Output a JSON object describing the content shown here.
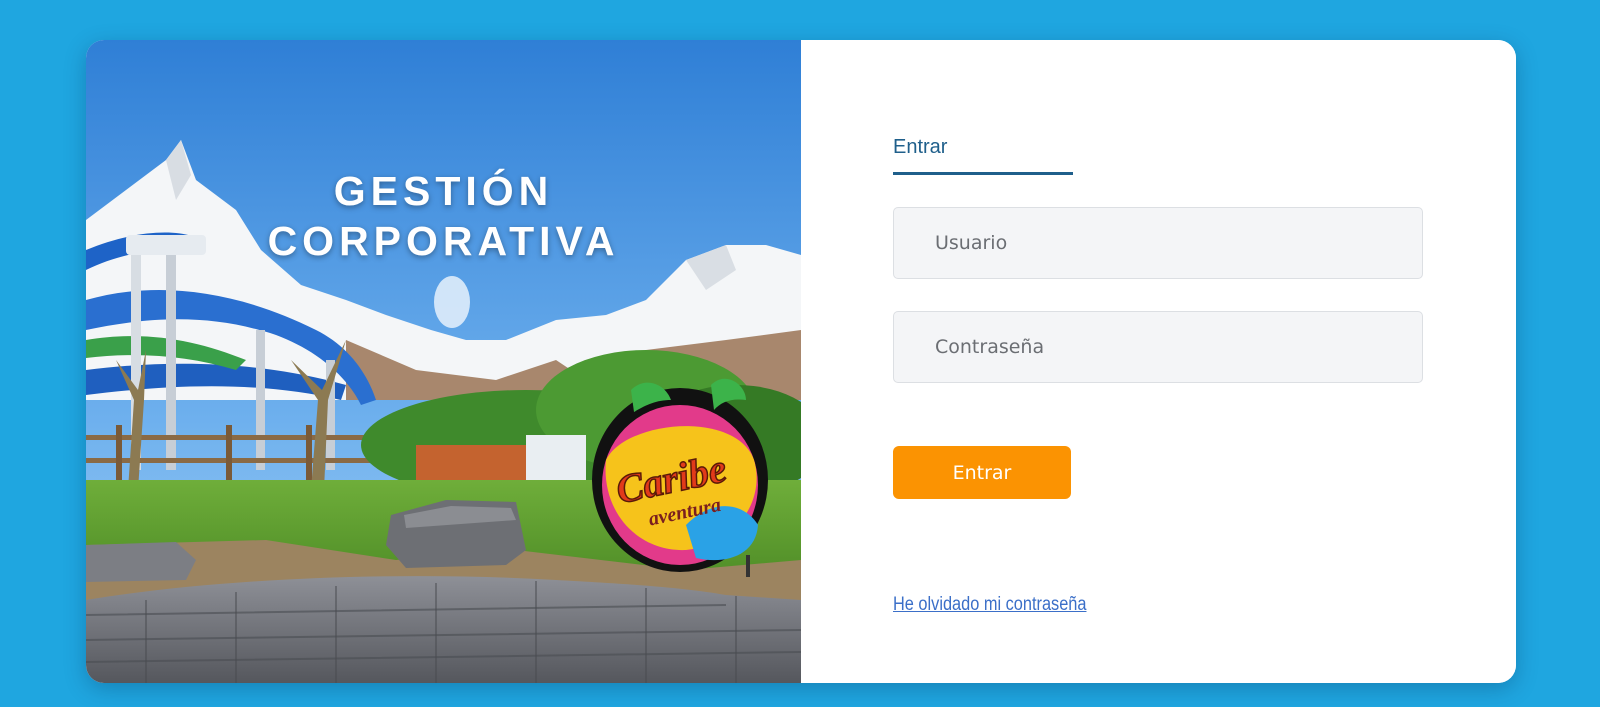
{
  "hero": {
    "title_line1": "GESTIÓN",
    "title_line2": "CORPORATIVA",
    "image_name": "water-park-photo",
    "sign_text_1": "Caribe",
    "sign_text_2": "aventura"
  },
  "login": {
    "tab_label": "Entrar",
    "username_placeholder": "Usuario",
    "password_placeholder": "Contraseña",
    "submit_label": "Entrar",
    "forgot_link": "He olvidado mi contraseña"
  },
  "colors": {
    "background": "#1fa6e0",
    "card": "#ffffff",
    "accent_button": "#fb9302",
    "tab_underline": "#1f5f8b",
    "link": "#3b6fc8",
    "input_bg": "#f4f5f7"
  }
}
